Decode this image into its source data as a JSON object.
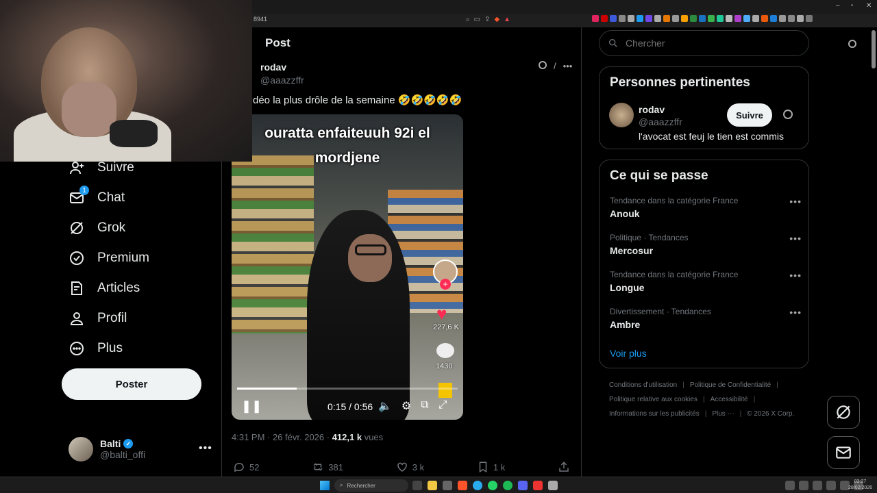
{
  "browser": {
    "url_fragment": "8941",
    "window_controls": [
      "–",
      "▫",
      "✕"
    ]
  },
  "nav": {
    "items": [
      {
        "label": "Suivre",
        "icon": "add-user-icon"
      },
      {
        "label": "Chat",
        "icon": "mail-icon",
        "badge": "1"
      },
      {
        "label": "Grok",
        "icon": "grok-icon"
      },
      {
        "label": "Premium",
        "icon": "verified-badge-icon"
      },
      {
        "label": "Articles",
        "icon": "article-edit-icon"
      },
      {
        "label": "Profil",
        "icon": "user-icon"
      },
      {
        "label": "Plus",
        "icon": "more-circle-icon"
      }
    ],
    "post_button": "Poster",
    "account": {
      "name": "Balti",
      "handle": "@balti_offi"
    }
  },
  "post": {
    "header": "Post",
    "author": {
      "name": "rodav",
      "handle": "@aaazzffr"
    },
    "text": "déo la plus drôle de la semaine 🤣🤣🤣🤣🤣",
    "video": {
      "caption_line1": "ouratta enfaiteuuh 92i el",
      "caption_line2": "mordjene",
      "likes": "227,6 K",
      "comments": "1430",
      "time": "0:15 / 0:56",
      "progress": 0.27
    },
    "meta": {
      "time": "4:31 PM · 26 févr. 2026 · ",
      "views": "412,1 k",
      "views_suffix": " vues"
    },
    "engagement": {
      "replies": "52",
      "reposts": "381",
      "likes": "3 k",
      "bookmarks": "1 k"
    }
  },
  "search": {
    "placeholder": "Chercher"
  },
  "relevant": {
    "title": "Personnes pertinentes",
    "person": {
      "name": "rodav",
      "handle": "@aaazzffr",
      "bio": "l'avocat est feuj le tien est commis",
      "follow_label": "Suivre"
    }
  },
  "trends": {
    "title": "Ce qui se passe",
    "items": [
      {
        "category": "Tendance dans la catégorie France",
        "name": "Anouk"
      },
      {
        "category": "Politique · Tendances",
        "name": "Mercosur"
      },
      {
        "category": "Tendance dans la catégorie France",
        "name": "Longue"
      },
      {
        "category": "Divertissement · Tendances",
        "name": "Ambre"
      }
    ],
    "more": "Voir plus"
  },
  "footer": {
    "links": [
      "Conditions d'utilisation",
      "Politique de Confidentialité",
      "Politique relative aux cookies",
      "Accessibilité",
      "Informations sur les publicités",
      "Plus ···"
    ],
    "copyright": "© 2026 X Corp."
  },
  "taskbar": {
    "search_label": "Rechercher",
    "time": "03:27",
    "date": "28/02/2026"
  },
  "colors": {
    "accent": "#1d9bf0",
    "background": "#000000",
    "tiktok_red": "#fe2c55"
  }
}
